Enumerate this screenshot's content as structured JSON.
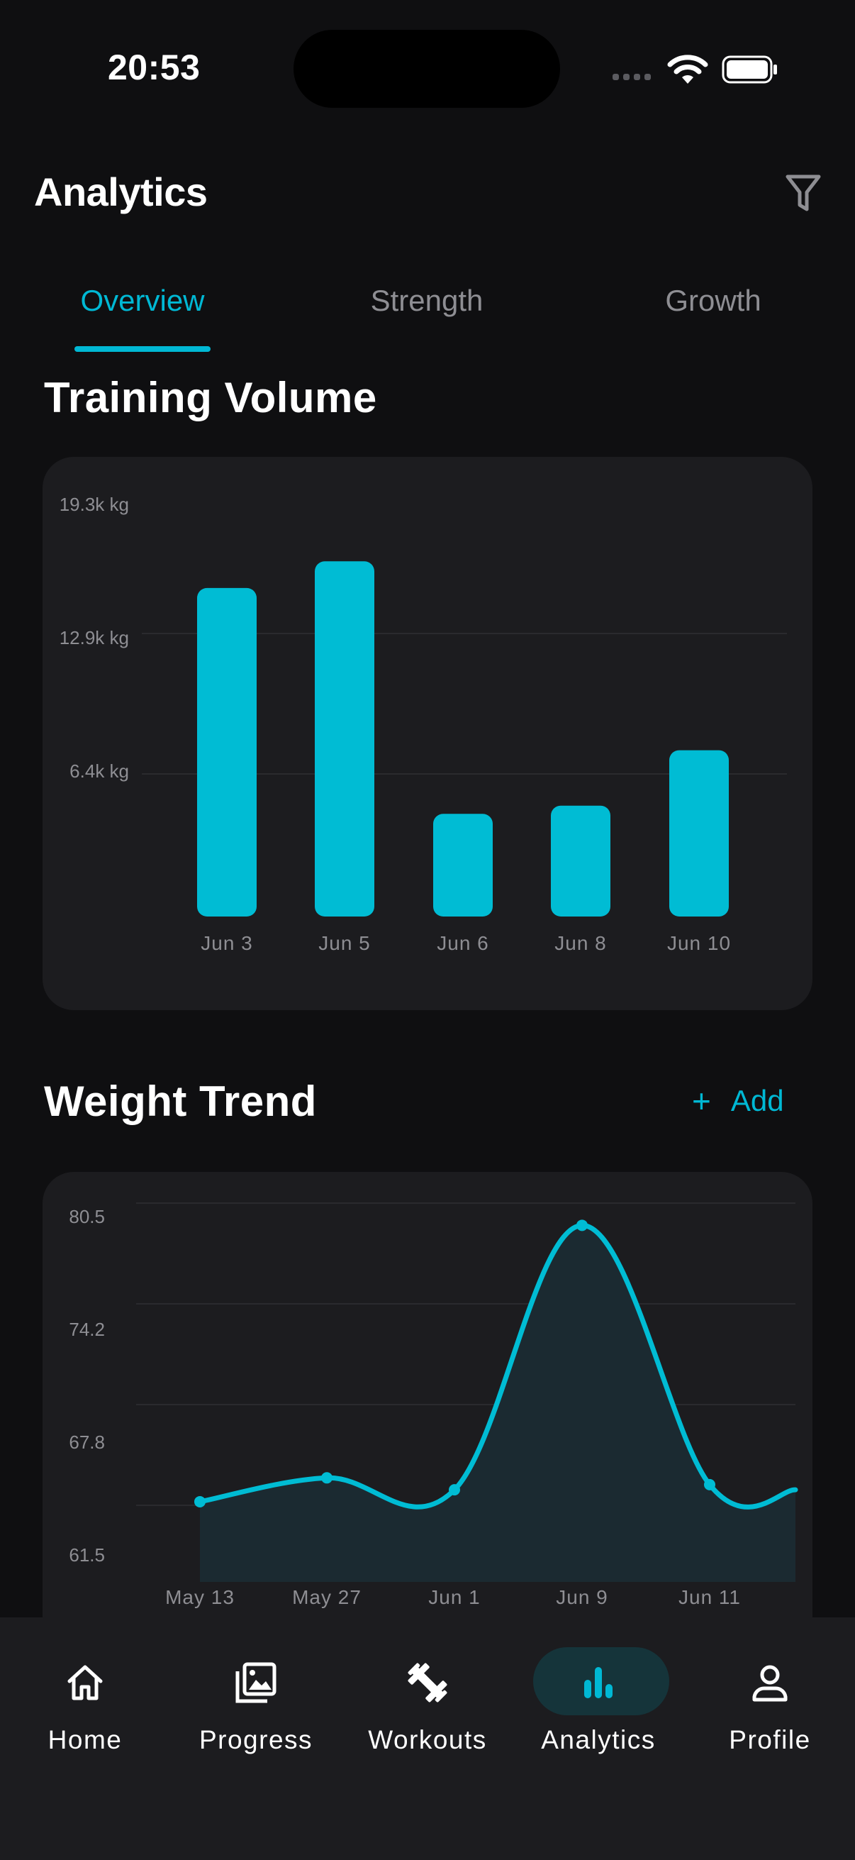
{
  "status": {
    "time": "20:53"
  },
  "header": {
    "title": "Analytics"
  },
  "tabs": [
    {
      "label": "Overview",
      "active": true
    },
    {
      "label": "Strength",
      "active": false
    },
    {
      "label": "Growth",
      "active": false
    }
  ],
  "volume_section": {
    "title": "Training Volume"
  },
  "weight_section": {
    "title": "Weight Trend",
    "add_label": "Add"
  },
  "chart_data": [
    {
      "type": "bar",
      "title": "Training Volume",
      "categories": [
        "Jun 3",
        "Jun 5",
        "Jun 6",
        "Jun 8",
        "Jun 10"
      ],
      "values": [
        16.0,
        17.3,
        5.0,
        5.4,
        8.1
      ],
      "unit": "k kg",
      "yticks": [
        "19.3k kg",
        "12.9k kg",
        "6.4k kg"
      ],
      "ylim": [
        0,
        20.8
      ],
      "color": "#00bcd4"
    },
    {
      "type": "area",
      "title": "Weight Trend",
      "categories": [
        "May 13",
        "May 27",
        "Jun 1",
        "Jun 9",
        "Jun 11"
      ],
      "values": [
        63.8,
        65.2,
        64.5,
        80.0,
        64.8
      ],
      "trailing_value": 64.5,
      "yticks": [
        "80.5",
        "74.2",
        "67.8",
        "61.5"
      ],
      "ylim": [
        59.1,
        82.3
      ],
      "color": "#00bcd4"
    }
  ],
  "nav": [
    {
      "label": "Home",
      "icon": "home-icon",
      "active": false
    },
    {
      "label": "Progress",
      "icon": "gallery-icon",
      "active": false
    },
    {
      "label": "Workouts",
      "icon": "dumbbell-icon",
      "active": false
    },
    {
      "label": "Analytics",
      "icon": "bar-chart-icon",
      "active": true
    },
    {
      "label": "Profile",
      "icon": "user-icon",
      "active": false
    }
  ],
  "colors": {
    "accent": "#00b8d4",
    "background": "#0f0f11",
    "card": "#1c1c1f",
    "muted": "#8e8e93"
  }
}
